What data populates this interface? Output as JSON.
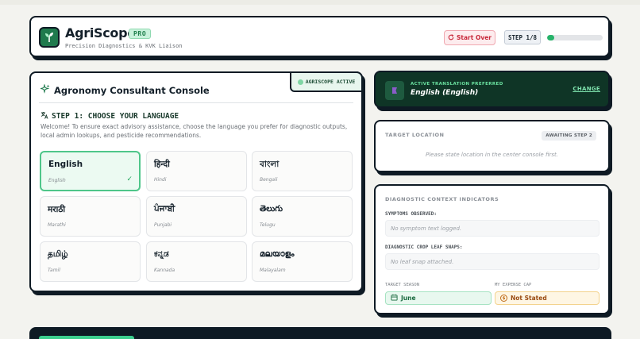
{
  "header": {
    "brand": "AgriScope",
    "badge": "PRO",
    "tagline": "Precision Diagnostics & KVK Liaison",
    "start_over": "Start Over",
    "step": "STEP 1/8",
    "progress": 0.125
  },
  "console": {
    "title": "Agronomy Consultant Console",
    "status_tag": "AGRISCOPE ACTIVE",
    "step_heading": "STEP 1: CHOOSE YOUR LANGUAGE",
    "step_text": "Welcome! To ensure exact advisory assistance, choose the language you prefer for diagnostic outputs, local admin lookups, and pesticide recommendations.",
    "languages": [
      {
        "name": "English",
        "sub": "English",
        "selected": true
      },
      {
        "name": "हिन्दी",
        "sub": "Hindi"
      },
      {
        "name": "বাংলা",
        "sub": "Bengali"
      },
      {
        "name": "मराठी",
        "sub": "Marathi"
      },
      {
        "name": "ਪੰਜਾਬੀ",
        "sub": "Punjabi"
      },
      {
        "name": "తెలుగు",
        "sub": "Telugu"
      },
      {
        "name": "தமிழ்",
        "sub": "Tamil"
      },
      {
        "name": "ಕನ್ನಡ",
        "sub": "Kannada"
      },
      {
        "name": "മലയാളം",
        "sub": "Malayalam"
      }
    ],
    "check_glyph": "✓"
  },
  "translation": {
    "label": "ACTIVE TRANSLATION PREFERRED",
    "value": "English (English)",
    "change": "CHANGE"
  },
  "location": {
    "label": "TARGET LOCATION",
    "badge": "AWAITING STEP 2",
    "hint": "Please state location in the center console first."
  },
  "diagnostics": {
    "label": "DIAGNOSTIC CONTEXT INDICATORS",
    "symptoms_label": "SYMPTOMS OBSERVED:",
    "symptoms_value": "No symptom text logged.",
    "snaps_label": "DIAGNOSTIC CROP LEAF SNAPS:",
    "snaps_value": "No leaf snap attached.",
    "season_label": "TARGET SEASON",
    "season_value": "June",
    "expense_label": "MY EXPENSE CAP",
    "expense_value": "Not Stated"
  },
  "colors": {
    "accent_green": "#27b36a",
    "dark_panel": "#0f3526",
    "danger": "#c8283a",
    "ink": "#0e1a24"
  }
}
